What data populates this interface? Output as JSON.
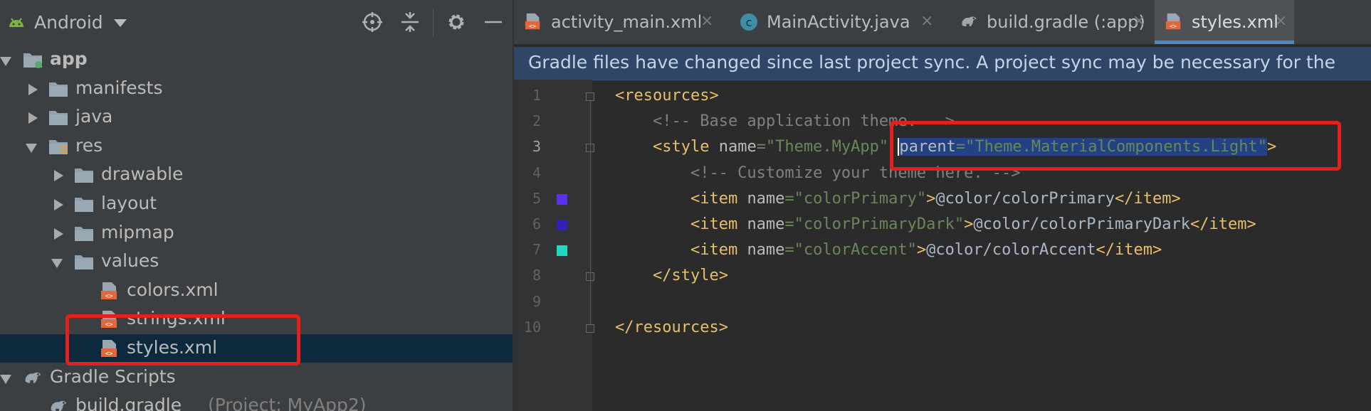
{
  "project_panel": {
    "view_label": "Android",
    "tree": [
      {
        "label": "app",
        "bold": true,
        "arrow": "down",
        "indent": 0,
        "icon": "module-folder-icon"
      },
      {
        "label": "manifests",
        "arrow": "right",
        "indent": 1,
        "icon": "folder-icon"
      },
      {
        "label": "java",
        "arrow": "right",
        "indent": 1,
        "icon": "folder-icon"
      },
      {
        "label": "res",
        "arrow": "down",
        "indent": 1,
        "icon": "res-folder-icon"
      },
      {
        "label": "drawable",
        "arrow": "right",
        "indent": 2,
        "icon": "folder-icon"
      },
      {
        "label": "layout",
        "arrow": "right",
        "indent": 2,
        "icon": "folder-icon"
      },
      {
        "label": "mipmap",
        "arrow": "right",
        "indent": 2,
        "icon": "folder-icon"
      },
      {
        "label": "values",
        "arrow": "down",
        "indent": 2,
        "icon": "folder-icon"
      },
      {
        "label": "colors.xml",
        "arrow": "",
        "indent": 3,
        "icon": "xml-file-icon"
      },
      {
        "label": "strings.xml",
        "arrow": "",
        "indent": 3,
        "icon": "xml-file-icon"
      },
      {
        "label": "styles.xml",
        "arrow": "",
        "indent": 3,
        "icon": "xml-file-icon",
        "selected": true
      },
      {
        "label": "Gradle Scripts",
        "arrow": "down",
        "indent": 0,
        "icon": "gradle-icon"
      },
      {
        "label": "build.gradle",
        "sub": "(Project: MyApp2)",
        "arrow": "",
        "indent": 1,
        "icon": "gradle-icon"
      }
    ]
  },
  "tabs": [
    {
      "label": "activity_main.xml",
      "icon": "xml-file-icon",
      "active": false
    },
    {
      "label": "MainActivity.java",
      "icon": "java-class-icon",
      "active": false
    },
    {
      "label": "build.gradle (:app)",
      "icon": "gradle-icon",
      "active": false
    },
    {
      "label": "styles.xml",
      "icon": "xml-file-icon",
      "active": true
    }
  ],
  "tab_close_glyph": "×",
  "banner": {
    "text": "Gradle files have changed since last project sync. A project sync may be necessary for the"
  },
  "editor": {
    "current_line": 3,
    "line_numbers": [
      "1",
      "2",
      "3",
      "4",
      "5",
      "6",
      "7",
      "8",
      "9",
      "10"
    ],
    "swatches": [
      {
        "line": 5,
        "color": "#5a2ff0"
      },
      {
        "line": 6,
        "color": "#3220b8"
      },
      {
        "line": 7,
        "color": "#1ed9c2"
      }
    ],
    "lines": [
      [
        {
          "t": "<resources>",
          "c": "tag"
        }
      ],
      [
        {
          "t": "    <!-- Base application theme. -->",
          "c": "com"
        }
      ],
      [
        {
          "t": "    <style ",
          "c": "tag"
        },
        {
          "t": "name",
          "c": "attr"
        },
        {
          "t": "=\"Theme.MyApp\"",
          "c": "val"
        },
        {
          "t": " ",
          "c": "txt"
        },
        {
          "t": "parent",
          "c": "attr",
          "sel": true,
          "caret": true
        },
        {
          "t": "=\"Theme.MaterialComponents.Light\"",
          "c": "val",
          "sel": true
        },
        {
          "t": ">",
          "c": "tag"
        }
      ],
      [
        {
          "t": "        <!-- Customize your theme here. -->",
          "c": "com"
        }
      ],
      [
        {
          "t": "        <item ",
          "c": "tag"
        },
        {
          "t": "name",
          "c": "attr"
        },
        {
          "t": "=\"colorPrimary\"",
          "c": "val"
        },
        {
          "t": ">",
          "c": "tag"
        },
        {
          "t": "@color/colorPrimary",
          "c": "txt"
        },
        {
          "t": "</item>",
          "c": "tag"
        }
      ],
      [
        {
          "t": "        <item ",
          "c": "tag"
        },
        {
          "t": "name",
          "c": "attr"
        },
        {
          "t": "=\"colorPrimaryDark\"",
          "c": "val"
        },
        {
          "t": ">",
          "c": "tag"
        },
        {
          "t": "@color/colorPrimaryDark",
          "c": "txt"
        },
        {
          "t": "</item>",
          "c": "tag"
        }
      ],
      [
        {
          "t": "        <item ",
          "c": "tag"
        },
        {
          "t": "name",
          "c": "attr"
        },
        {
          "t": "=\"colorAccent\"",
          "c": "val"
        },
        {
          "t": ">",
          "c": "tag"
        },
        {
          "t": "@color/colorAccent",
          "c": "txt"
        },
        {
          "t": "</item>",
          "c": "tag"
        }
      ],
      [
        {
          "t": "    </style>",
          "c": "tag"
        }
      ],
      [],
      [
        {
          "t": "</resources>",
          "c": "tag"
        }
      ]
    ]
  },
  "colors": {
    "selection": "#214283",
    "annotation_red": "#e3201b",
    "accent_tab_underline": "#4a88c7"
  }
}
